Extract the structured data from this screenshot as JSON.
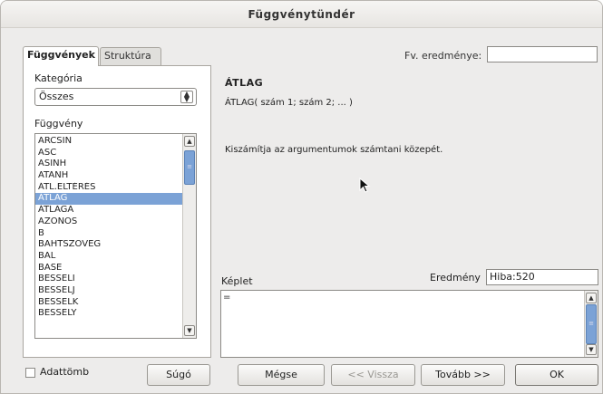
{
  "window": {
    "title": "Függvénytündér"
  },
  "tabs": [
    {
      "label": "Függvények"
    },
    {
      "label": "Struktúra"
    }
  ],
  "category": {
    "label": "Kategória",
    "value": "Összes"
  },
  "function_list": {
    "label": "Függvény",
    "items": [
      "ARCSIN",
      "ASC",
      "ASINH",
      "ATANH",
      "ÁTL.ELTÉRÉS",
      "ÁTLAG",
      "ÁTLAGA",
      "AZONOS",
      "B",
      "BAHTSZÖVEG",
      "BAL",
      "BASE",
      "BESSELI",
      "BESSELJ",
      "BESSELK",
      "BESSELY"
    ],
    "selected": "ÁTLAG"
  },
  "function_result": {
    "label": "Fv. eredménye:",
    "value": ""
  },
  "details": {
    "name": "ÁTLAG",
    "syntax": "ÁTLAG( szám 1; szám 2; ... )",
    "description": "Kiszámítja az argumentumok számtani közepét."
  },
  "formula": {
    "label": "Képlet",
    "value": "="
  },
  "result": {
    "label": "Eredmény",
    "value": "Hiba:520"
  },
  "array_checkbox": {
    "label": "Adattömb",
    "checked": false
  },
  "buttons": {
    "help": "Súgó",
    "cancel": "Mégse",
    "back": "<< Vissza",
    "next": "Tovább >>",
    "ok": "OK"
  },
  "colors": {
    "selection": "#7ba2d6",
    "dialog_bg": "#edeceb"
  }
}
